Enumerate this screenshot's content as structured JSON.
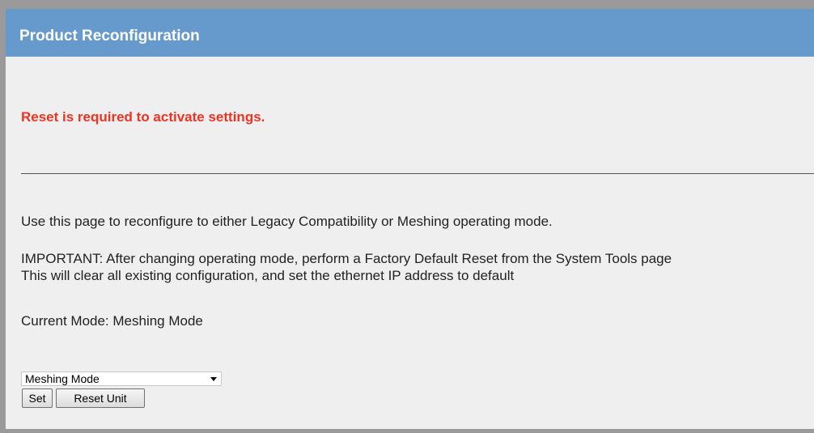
{
  "header": {
    "title": "Product Reconfiguration"
  },
  "notice": {
    "text": "Reset is required to activate settings.",
    "color": "#ee3322"
  },
  "body": {
    "intro": "Use this page to reconfigure to either Legacy Compatibility or Meshing operating mode.",
    "important_line1": "IMPORTANT: After changing operating mode, perform a Factory Default Reset from the System Tools page",
    "important_line2": "This will clear all existing configuration, and set the ethernet IP address to default",
    "current_mode": "Current Mode: Meshing Mode"
  },
  "form": {
    "mode_select_value": "Meshing Mode",
    "set_label": "Set",
    "reset_label": "Reset Unit"
  },
  "colors": {
    "header_bg": "#6699cc",
    "panel_bg": "#efefef"
  },
  "icons": {
    "dropdown": "chevron-down-icon"
  }
}
